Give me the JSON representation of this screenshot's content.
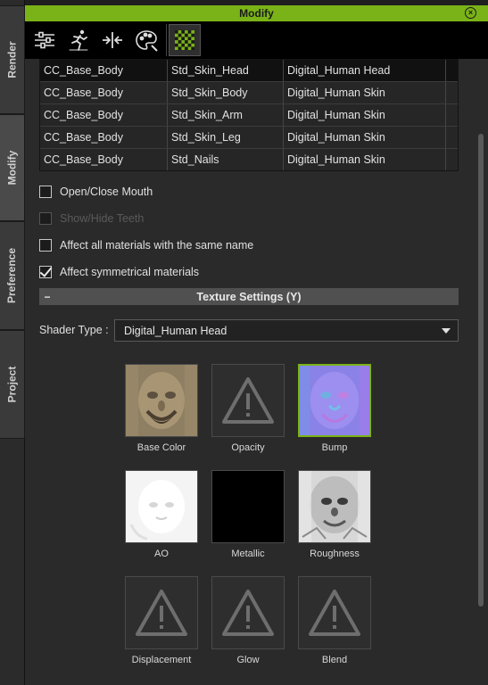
{
  "window": {
    "title": "Modify"
  },
  "side_tabs": [
    {
      "label": "Render"
    },
    {
      "label": "Modify"
    },
    {
      "label": "Preference"
    },
    {
      "label": "Project"
    }
  ],
  "toolbar": {
    "tools": [
      "sliders-icon",
      "running-figure-icon",
      "align-arrows-icon",
      "palette-icon",
      "checker-material-icon"
    ],
    "active": "checker-material-icon"
  },
  "materials_table": {
    "rows": [
      {
        "object": "CC_Base_Body",
        "material": "Std_Skin_Head",
        "shader": "Digital_Human Head",
        "selected": true
      },
      {
        "object": "CC_Base_Body",
        "material": "Std_Skin_Body",
        "shader": "Digital_Human Skin",
        "selected": false
      },
      {
        "object": "CC_Base_Body",
        "material": "Std_Skin_Arm",
        "shader": "Digital_Human Skin",
        "selected": false
      },
      {
        "object": "CC_Base_Body",
        "material": "Std_Skin_Leg",
        "shader": "Digital_Human Skin",
        "selected": false
      },
      {
        "object": "CC_Base_Body",
        "material": "Std_Nails",
        "shader": "Digital_Human Skin",
        "selected": false
      }
    ]
  },
  "options": [
    {
      "label": "Open/Close Mouth",
      "checked": false,
      "disabled": false
    },
    {
      "label": "Show/Hide Teeth",
      "checked": false,
      "disabled": true
    },
    {
      "label": "Affect all materials with the same name",
      "checked": false,
      "disabled": false
    },
    {
      "label": "Affect symmetrical materials",
      "checked": true,
      "disabled": false
    }
  ],
  "texture_settings": {
    "header": "Texture Settings  (Y)",
    "collapse_glyph": "−",
    "shader_label": "Shader Type :",
    "shader_value": "Digital_Human Head",
    "textures": [
      {
        "label": "Base Color",
        "kind": "face-diffuse"
      },
      {
        "label": "Opacity",
        "kind": "empty"
      },
      {
        "label": "Bump",
        "kind": "face-normal",
        "selected": true
      },
      {
        "label": "AO",
        "kind": "face-ao"
      },
      {
        "label": "Metallic",
        "kind": "black"
      },
      {
        "label": "Roughness",
        "kind": "face-roughness"
      },
      {
        "label": "Displacement",
        "kind": "empty"
      },
      {
        "label": "Glow",
        "kind": "empty"
      },
      {
        "label": "Blend",
        "kind": "empty"
      }
    ]
  },
  "colors": {
    "accent": "#7ab317",
    "panel": "#2a2a2a",
    "toolbar": "#000000"
  }
}
